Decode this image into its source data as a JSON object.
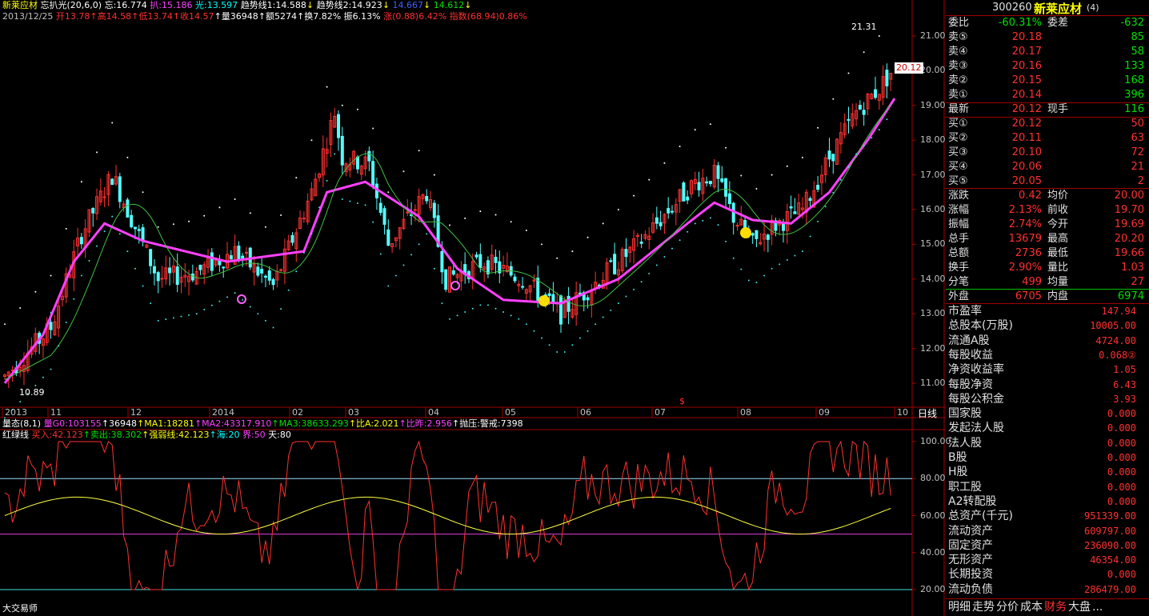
{
  "header": {
    "stock_name": "新莱应材",
    "ind_name": "忘扒光(20,6,0)",
    "wang_label": "忘:16.774",
    "ba_label": "扒:15.186",
    "guang_label": "光:13.597",
    "trend1": "趋势线1:14.588",
    "trend2": "趋势线2:14.923",
    "val3": "14.667",
    "val4": "14.612",
    "date": "2013/12/25",
    "open": "开13.78",
    "high": "↑高14.58",
    "low": "↑低13.74",
    "close": "↑收14.57",
    "vol": "↑量36948",
    "amount": "↑额5274",
    "turnover": "↑换7.82%",
    "amplitude": "振6.13%",
    "change": "涨(0.88)6.42%",
    "index": "指数(68.94)0.86%"
  },
  "main_chart": {
    "y_ticks": [
      "21.00",
      "20.00",
      "19.00",
      "18.00",
      "17.00",
      "16.00",
      "15.00",
      "14.00",
      "13.00",
      "12.00",
      "11.00"
    ],
    "max_label": "21.31",
    "min_label": "10.89",
    "current_price": "20.12",
    "dollar_mark": "$",
    "x_labels": [
      "2013",
      "11",
      "12",
      "2014",
      "02",
      "03",
      "04",
      "05",
      "06",
      "07",
      "08",
      "09",
      "10"
    ],
    "period": "日线"
  },
  "sub1": {
    "label": "量态(8,1)",
    "g0": "量G0:103155",
    "v1": "↑36948",
    "ma1": "↑MA1:18281",
    "ma2": "↑MA2:43317.910",
    "ma3": "↑MA3:38633.293",
    "bia": "↑比A:2.021",
    "bizuo": "↑比昨:2.956",
    "paoya": "↑抛压:警戒:7398"
  },
  "sub2": {
    "label": "红绿线",
    "buy": "买入:42.123",
    "sell": "↑卖出:38.302",
    "strong": "↑强弱线:42.123",
    "sea": "↑海:20",
    "jie": "界:50",
    "tian": "天:80",
    "y_ticks": [
      "100.00",
      "80.00",
      "60.00",
      "40.00",
      "20.00"
    ],
    "footer": "大交易师"
  },
  "quote": {
    "code": "300260",
    "name": "新莱应材",
    "suffix": "(4)",
    "weibi_label": "委比",
    "weibi": "-60.31%",
    "weicha_label": "委差",
    "weicha": "-632",
    "asks": [
      {
        "label": "卖⑤",
        "price": "20.18",
        "vol": "85"
      },
      {
        "label": "卖④",
        "price": "20.17",
        "vol": "58"
      },
      {
        "label": "卖③",
        "price": "20.16",
        "vol": "133"
      },
      {
        "label": "卖②",
        "price": "20.15",
        "vol": "168"
      },
      {
        "label": "卖①",
        "price": "20.14",
        "vol": "396"
      }
    ],
    "latest_label": "最新",
    "latest": "20.12",
    "xianshou_label": "现手",
    "xianshou": "116",
    "bids": [
      {
        "label": "买①",
        "price": "20.12",
        "vol": "50"
      },
      {
        "label": "买②",
        "price": "20.11",
        "vol": "63"
      },
      {
        "label": "买③",
        "price": "20.10",
        "vol": "72"
      },
      {
        "label": "买④",
        "price": "20.06",
        "vol": "21"
      },
      {
        "label": "买⑤",
        "price": "20.05",
        "vol": "2"
      }
    ],
    "stats": [
      {
        "l1": "涨跌",
        "v1": "0.42",
        "l2": "均价",
        "v2": "20.00"
      },
      {
        "l1": "涨幅",
        "v1": "2.13%",
        "l2": "前收",
        "v2": "19.70"
      },
      {
        "l1": "振幅",
        "v1": "2.74%",
        "l2": "今开",
        "v2": "19.69"
      },
      {
        "l1": "总手",
        "v1": "13679",
        "l2": "最高",
        "v2": "20.20"
      },
      {
        "l1": "总额",
        "v1": "2736",
        "l2": "最低",
        "v2": "19.66"
      },
      {
        "l1": "换手",
        "v1": "2.90%",
        "l2": "量比",
        "v2": "1.03"
      },
      {
        "l1": "分笔",
        "v1": "499",
        "l2": "均量",
        "v2": "27"
      }
    ],
    "waipan_label": "外盘",
    "waipan": "6705",
    "neipan_label": "内盘",
    "neipan": "6974"
  },
  "finance": [
    {
      "label": "市盈率",
      "value": "147.94"
    },
    {
      "label": "总股本(万股)",
      "value": "10005.00"
    },
    {
      "label": "流通A股",
      "value": "4724.00"
    },
    {
      "label": "每股收益",
      "value": "0.068②"
    },
    {
      "label": "净资收益率",
      "value": "1.05"
    },
    {
      "label": "每股净资",
      "value": "6.43"
    },
    {
      "label": "每股公积金",
      "value": "3.93"
    },
    {
      "label": "国家股",
      "value": "0.000"
    },
    {
      "label": "发起法人股",
      "value": "0.000"
    },
    {
      "label": "法人股",
      "value": "0.000"
    },
    {
      "label": "B股",
      "value": "0.000"
    },
    {
      "label": "H股",
      "value": "0.000"
    },
    {
      "label": "职工股",
      "value": "0.000"
    },
    {
      "label": "A2转配股",
      "value": "0.000"
    },
    {
      "label": "总资产(千元)",
      "value": "951339.00"
    },
    {
      "label": "流动资产",
      "value": "609797.00"
    },
    {
      "label": "固定资产",
      "value": "236090.00"
    },
    {
      "label": "无形资产",
      "value": "46354.00"
    },
    {
      "label": "长期投资",
      "value": "0.000"
    },
    {
      "label": "流动负债",
      "value": "286479.00"
    }
  ],
  "tabs": [
    "明细",
    "走势",
    "分价",
    "成本",
    "财务",
    "大盘",
    "..."
  ],
  "active_tab": "财务"
}
